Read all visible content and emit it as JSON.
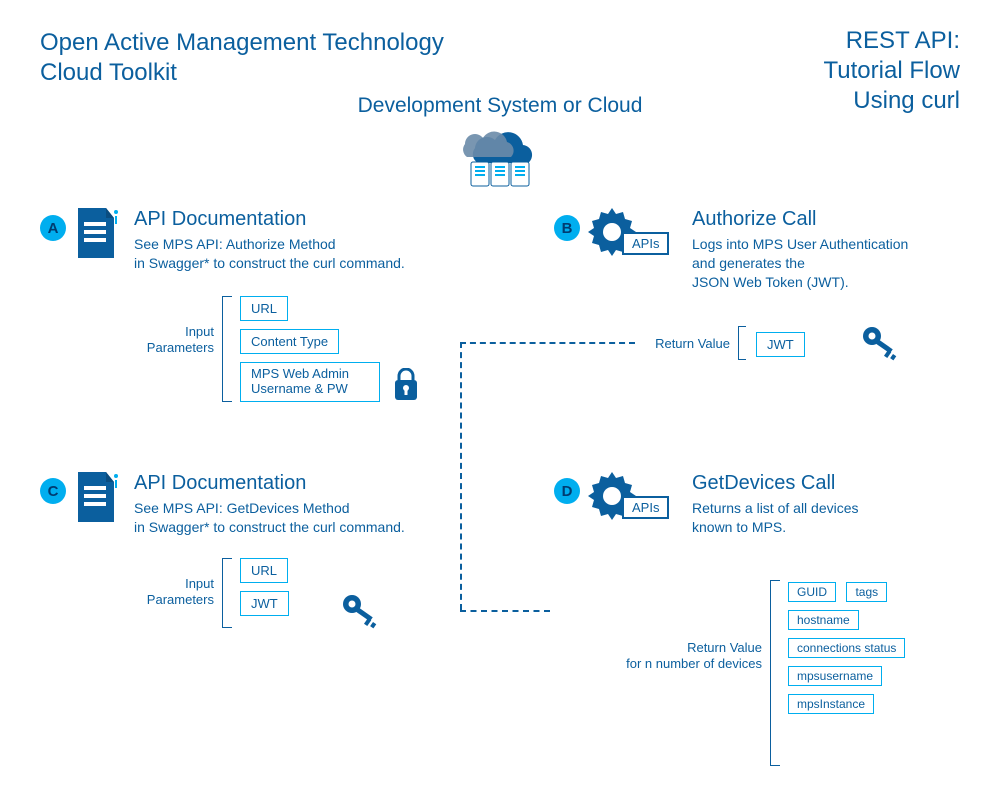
{
  "title_left_line1": "Open Active Management Technology",
  "title_left_line2": "Cloud Toolkit",
  "title_right_line1": "REST API:",
  "title_right_line2": "Tutorial Flow",
  "title_right_line3": "Using curl",
  "dev_system_label": "Development System or Cloud",
  "badges": {
    "a": "A",
    "b": "B",
    "c": "C",
    "d": "D"
  },
  "sectionA": {
    "title": "API Documentation",
    "body1": "See MPS API: Authorize Method",
    "body2": "in Swagger* to construct the curl command.",
    "param_label1": "Input",
    "param_label2": "Parameters",
    "params": {
      "p1": "URL",
      "p2": "Content Type",
      "p3": "MPS Web Admin Username & PW"
    }
  },
  "sectionB": {
    "title": "Authorize Call",
    "body1": "Logs into MPS User Authentication",
    "body2": "and generates the",
    "body3": "JSON Web Token (JWT).",
    "apis": "APIs",
    "return_label": "Return Value",
    "return_value": "JWT"
  },
  "sectionC": {
    "title": "API Documentation",
    "body1": "See MPS API: GetDevices Method",
    "body2": "in Swagger* to construct the curl command.",
    "param_label1": "Input",
    "param_label2": "Parameters",
    "params": {
      "p1": "URL",
      "p2": "JWT"
    }
  },
  "sectionD": {
    "title": "GetDevices Call",
    "body1": "Returns a list of all devices",
    "body2": "known to MPS.",
    "apis": "APIs",
    "return_label1": "Return Value",
    "return_label2": "for n number of devices",
    "returns": {
      "r1": "GUID",
      "r2": "tags",
      "r3": "hostname",
      "r4": "connections status",
      "r5": "mpsusername",
      "r6": "mpsInstance"
    }
  }
}
